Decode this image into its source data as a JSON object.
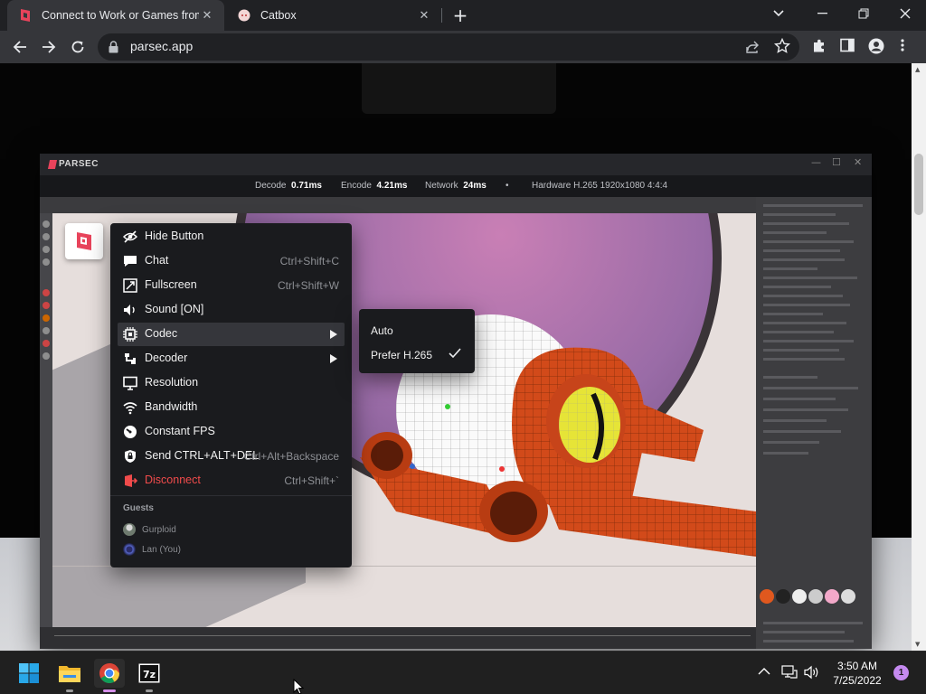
{
  "browser": {
    "tabs": [
      {
        "title": "Connect to Work or Games from",
        "favicon": "parsec-logo",
        "active": true
      },
      {
        "title": "Catbox",
        "favicon": "catbox-logo",
        "active": false
      }
    ],
    "url": "parsec.app"
  },
  "parsec": {
    "app_title": "PARSEC",
    "stats": {
      "decode_label": "Decode",
      "decode_value": "0.71ms",
      "encode_label": "Encode",
      "encode_value": "4.21ms",
      "network_label": "Network",
      "network_value": "24ms",
      "hardware": "Hardware H.265 1920x1080 4:4:4"
    },
    "menu": {
      "items": [
        {
          "label": "Hide Button",
          "shortcut": "",
          "icon": "eye-off-icon"
        },
        {
          "label": "Chat",
          "shortcut": "Ctrl+Shift+C",
          "icon": "chat-icon"
        },
        {
          "label": "Fullscreen",
          "shortcut": "Ctrl+Shift+W",
          "icon": "fullscreen-icon"
        },
        {
          "label": "Sound [ON]",
          "shortcut": "",
          "icon": "speaker-icon"
        },
        {
          "label": "Codec",
          "shortcut": "",
          "icon": "chip-icon",
          "submenu": true,
          "highlighted": true
        },
        {
          "label": "Decoder",
          "shortcut": "",
          "icon": "decoder-icon",
          "submenu": true
        },
        {
          "label": "Resolution",
          "shortcut": "",
          "icon": "monitor-icon"
        },
        {
          "label": "Bandwidth",
          "shortcut": "",
          "icon": "wifi-icon"
        },
        {
          "label": "Constant FPS",
          "shortcut": "",
          "icon": "gauge-icon"
        },
        {
          "label": "Send CTRL+ALT+DEL",
          "shortcut": "Ctrl+Alt+Backspace",
          "icon": "shield-lock-icon"
        },
        {
          "label": "Disconnect",
          "shortcut": "Ctrl+Shift+`",
          "icon": "disconnect-icon",
          "danger": true
        }
      ],
      "guests_header": "Guests",
      "guests": [
        {
          "name": "Gurploid"
        },
        {
          "name": "Lan (You)"
        }
      ]
    },
    "codec_submenu": {
      "options": [
        "Auto",
        "Prefer H.265"
      ],
      "selected": "Prefer H.265"
    }
  },
  "taskbar": {
    "apps": [
      "windows-start",
      "file-explorer",
      "chrome",
      "7-zip"
    ],
    "time": "3:50 AM",
    "date": "7/25/2022",
    "notification_count": "1"
  },
  "colors": {
    "accent_red": "#f04b4b",
    "parsec_brand": "#e8435b",
    "notification": "#c58af0"
  }
}
